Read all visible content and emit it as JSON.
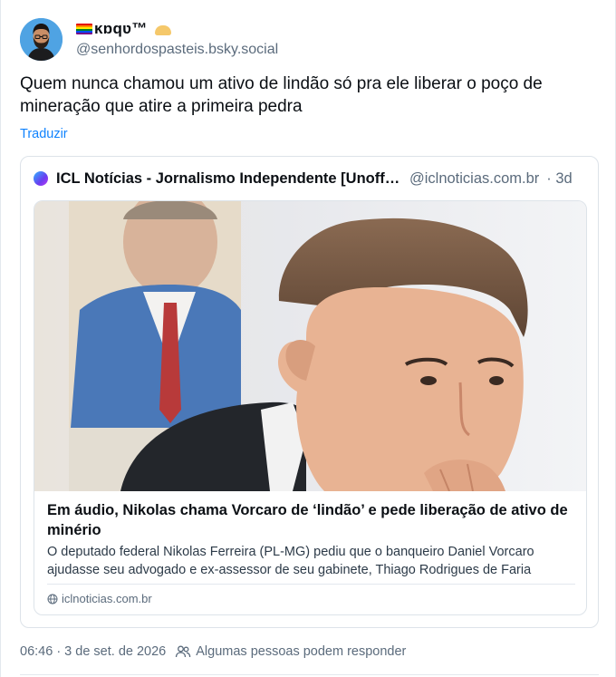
{
  "author": {
    "display_name": "ĸɒqʋ™",
    "handle": "@senhordospasteis.bsky.social",
    "avatar_icon": "bearded-man-avatar",
    "flag_icon": "rainbow-flag-icon",
    "emoji_icon": "pastel-emoji-icon"
  },
  "post": {
    "text": "Quem nunca chamou um ativo de lindão só pra ele liberar o poço de mineração que atire a primeira pedra",
    "translate_label": "Traduzir",
    "timestamp": "06:46 · 3 de set. de 2026",
    "reply_setting": "Algumas pessoas podem responder"
  },
  "quote": {
    "name": "ICL Notícias - Jornalismo Independente [Unofficial]",
    "handle": "@iclnoticias.com.br",
    "age": "· 3d",
    "link": {
      "title": "Em áudio, Nikolas chama Vorcaro de ‘lindão’ e pede liberação de ativo de minério",
      "description_line1": "O deputado federal Nikolas Ferreira (PL-MG) pediu que o banqueiro Daniel Vorcaro",
      "description_line2": "ajudasse seu advogado e ex-assessor de seu gabinete, Thiago Rodrigues de Faria",
      "domain": "iclnoticias.com.br"
    }
  },
  "colors": {
    "link_blue": "#1083fe",
    "muted": "#5b6b7c",
    "border": "#dde3e9"
  }
}
